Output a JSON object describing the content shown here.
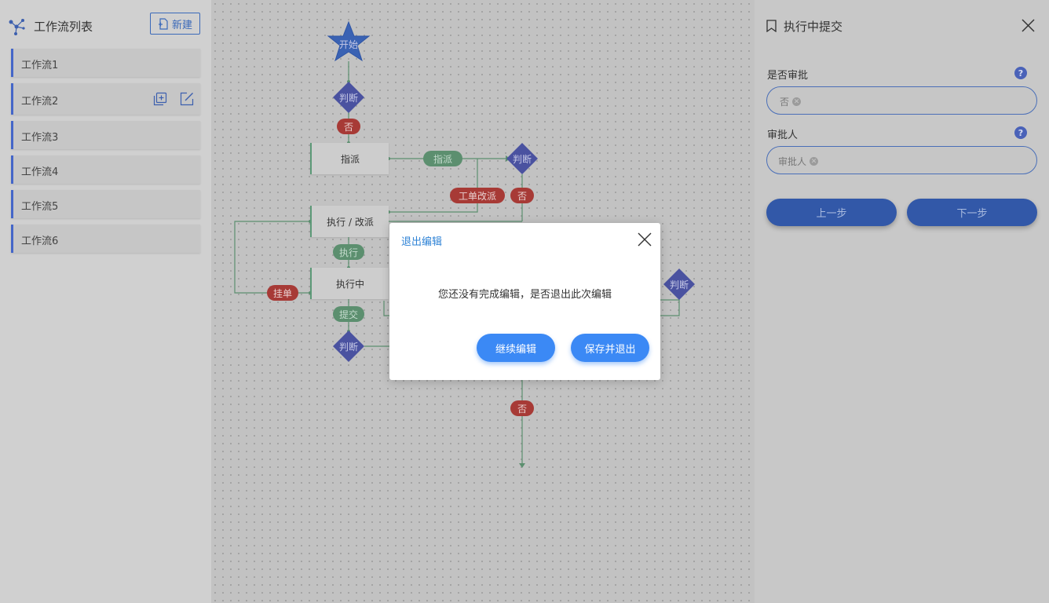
{
  "sidebar": {
    "title": "工作流列表",
    "new_button": "新建",
    "items": [
      {
        "label": "工作流1"
      },
      {
        "label": "工作流2"
      },
      {
        "label": "工作流3"
      },
      {
        "label": "工作流4"
      },
      {
        "label": "工作流5"
      },
      {
        "label": "工作流6"
      }
    ]
  },
  "canvas": {
    "start": "开始",
    "diamonds": [
      "判断",
      "判断",
      "判断",
      "判断"
    ],
    "nodes": [
      "指派",
      "执行 / 改派",
      "执行中"
    ],
    "edges": {
      "no_1": "否",
      "assign": "指派",
      "reassign": "工单改派",
      "no_2": "否",
      "execute": "执行",
      "hang": "挂单",
      "submit": "提交",
      "no_3": "否"
    }
  },
  "panel": {
    "title": "执行中提交",
    "field1_label": "是否审批",
    "field1_value": "否",
    "field2_label": "审批人",
    "field2_value": "审批人",
    "help": "?",
    "prev": "上一步",
    "next": "下一步"
  },
  "modal": {
    "title": "退出编辑",
    "message": "您还没有完成编辑，是否退出此次编辑",
    "continue": "继续编辑",
    "save_exit": "保存并退出"
  },
  "colors": {
    "accent": "#3b89f5",
    "edge_green": "#5c8f6f",
    "edge_red": "#a73a36",
    "diamond": "#4a52a0"
  }
}
